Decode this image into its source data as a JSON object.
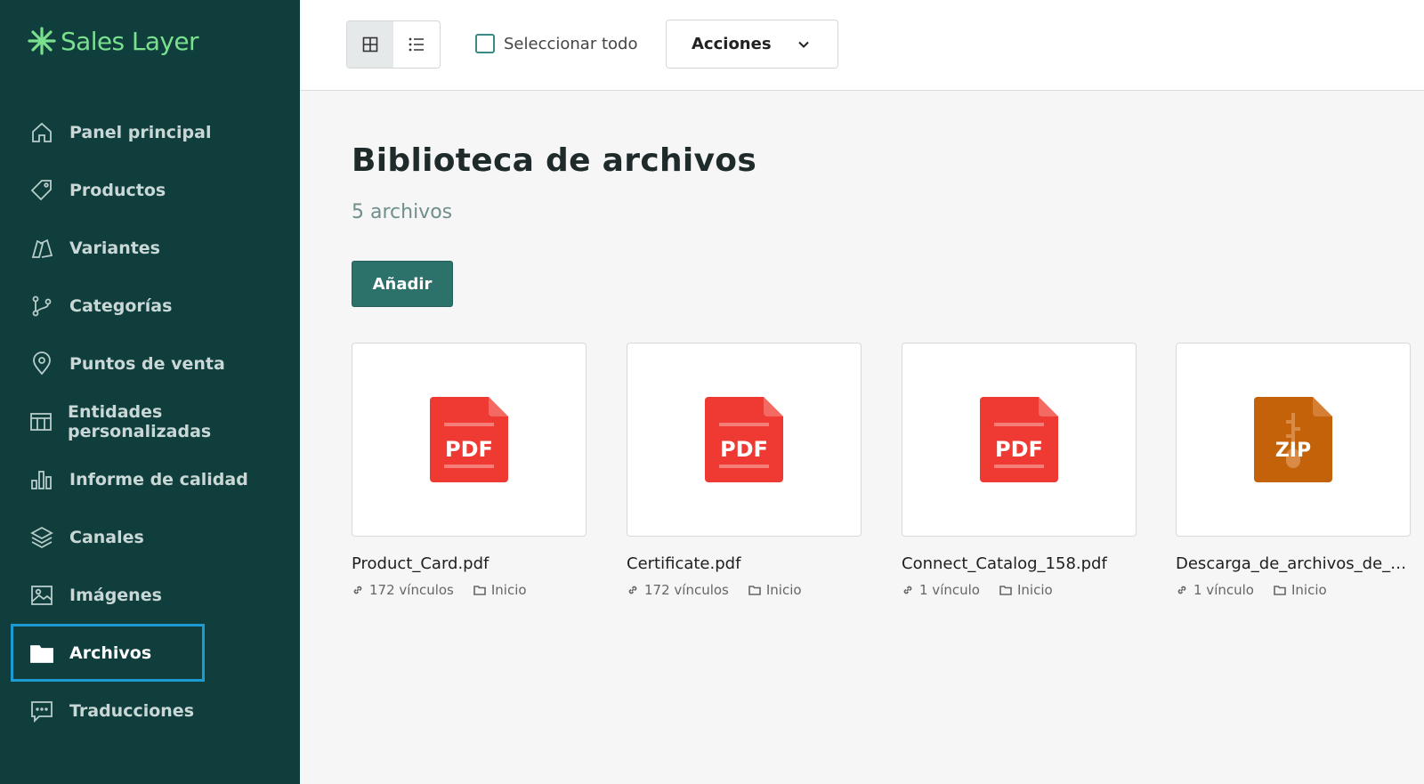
{
  "brand": {
    "name": "Sales Layer",
    "color": "#7ae08e"
  },
  "sidebar": {
    "items": [
      {
        "label": "Panel principal",
        "icon": "home-icon"
      },
      {
        "label": "Productos",
        "icon": "tag-icon"
      },
      {
        "label": "Variantes",
        "icon": "variants-icon"
      },
      {
        "label": "Categorías",
        "icon": "branch-icon"
      },
      {
        "label": "Puntos de venta",
        "icon": "map-pin-icon"
      },
      {
        "label": "Entidades personalizadas",
        "icon": "table-icon"
      },
      {
        "label": "Informe de calidad",
        "icon": "bar-chart-icon"
      },
      {
        "label": "Canales",
        "icon": "layers-icon"
      },
      {
        "label": "Imágenes",
        "icon": "image-icon"
      },
      {
        "label": "Archivos",
        "icon": "folder-icon",
        "active": true
      },
      {
        "label": "Traducciones",
        "icon": "chat-icon"
      }
    ]
  },
  "toolbar": {
    "view_modes": [
      "grid",
      "list"
    ],
    "selected_view": "grid",
    "select_all_label": "Seleccionar todo",
    "select_all_checked": false,
    "actions_label": "Acciones"
  },
  "main": {
    "title": "Biblioteca de archivos",
    "count_label": "5 archivos",
    "add_label": "Añadir",
    "files": [
      {
        "name": "Product_Card.pdf",
        "type": "PDF",
        "type_color": "#ee3a32",
        "links": "172 vínculos",
        "folder": "Inicio"
      },
      {
        "name": "Certificate.pdf",
        "type": "PDF",
        "type_color": "#ee3a32",
        "links": "172 vínculos",
        "folder": "Inicio"
      },
      {
        "name": "Connect_Catalog_158.pdf",
        "type": "PDF",
        "type_color": "#ee3a32",
        "links": "1 vínculo",
        "folder": "Inicio"
      },
      {
        "name": "Descarga_de_archivos_de_S...",
        "type": "ZIP",
        "type_color": "#c4620a",
        "links": "1 vínculo",
        "folder": "Inicio"
      }
    ]
  },
  "colors": {
    "sidebar_bg": "#0f3e3c",
    "accent": "#2d716b",
    "active_outline": "#1f9bd4"
  }
}
